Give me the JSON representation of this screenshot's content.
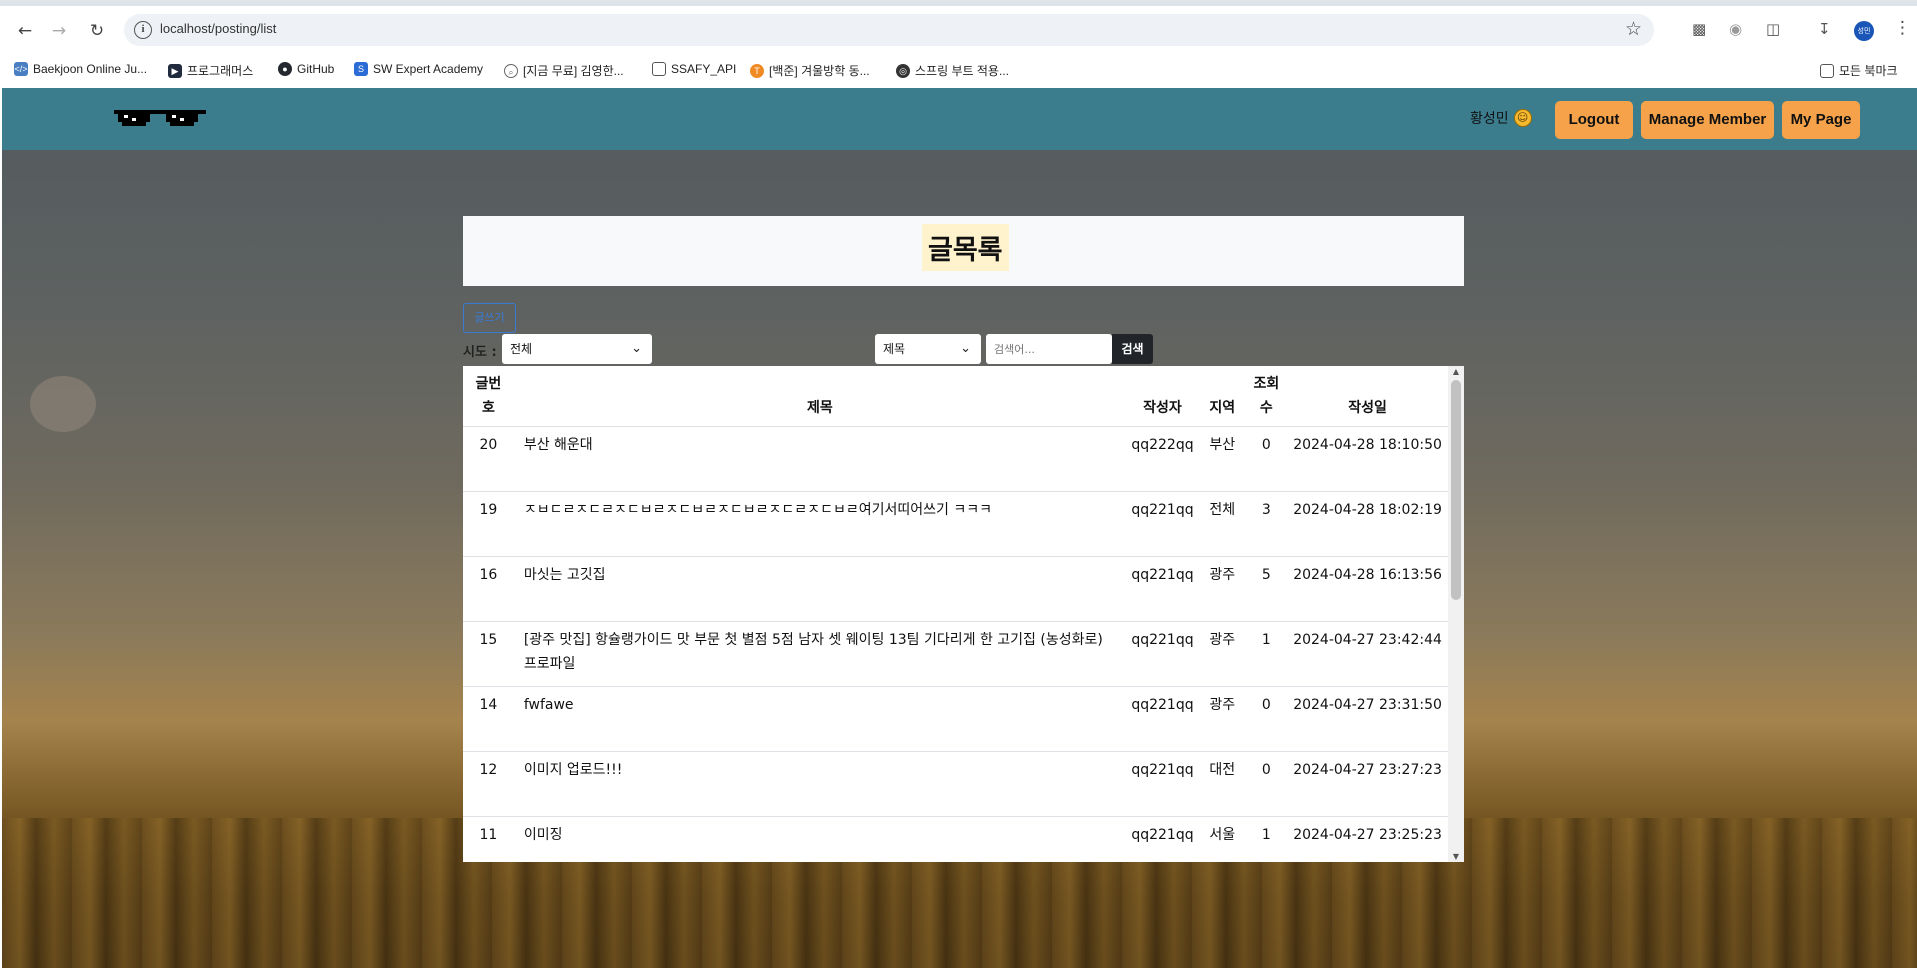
{
  "browser": {
    "url": "localhost/posting/list",
    "profile_initials": "성민",
    "bookmarks": [
      {
        "label": "Baekjoon Online Ju...",
        "icon": "code-icon",
        "color": "#4a7ec2"
      },
      {
        "label": "프로그래머스",
        "icon": "programmers-icon",
        "color": "#202b3d"
      },
      {
        "label": "GitHub",
        "icon": "github-icon",
        "color": "#24292f"
      },
      {
        "label": "SW Expert Academy",
        "icon": "swea-icon",
        "color": "#2a6bd6"
      },
      {
        "label": "[지금 무료] 김영한...",
        "icon": "search-icon",
        "color": "#666666"
      },
      {
        "label": "SSAFY_API",
        "icon": "folder-icon",
        "color": "#555555"
      },
      {
        "label": "[백준] 겨울방학 동...",
        "icon": "notion-icon",
        "color": "#f08a24"
      },
      {
        "label": "스프링 부트 적용...",
        "icon": "globe-icon",
        "color": "#333333"
      }
    ],
    "all_bookmarks": "모든 북마크"
  },
  "nav": {
    "username": "황성민",
    "logout": "Logout",
    "manage_member": "Manage Member",
    "my_page": "My Page"
  },
  "main": {
    "title": "글목록",
    "write_button": "글쓰기",
    "sido_label": "시도 :",
    "sido_selected": "전체",
    "search_field_selected": "제목",
    "search_placeholder": "검색어...",
    "search_button": "검색"
  },
  "table": {
    "headers": {
      "num_line1": "글번",
      "num_line2": "호",
      "title": "제목",
      "writer": "작성자",
      "region": "지역",
      "views_line1": "조회",
      "views_line2": "수",
      "date": "작성일"
    },
    "rows": [
      {
        "num": "20",
        "title": "부산 해운대",
        "writer": "qq222qq",
        "region": "부산",
        "views": "0",
        "date": "2024-04-28 18:10:50"
      },
      {
        "num": "19",
        "title": "ㅈㅂㄷㄹㅈㄷㄹㅈㄷㅂㄹㅈㄷㅂㄹㅈㄷㅂㄹㅈㄷㄹㅈㄷㅂㄹ여기서띠어쓰기 ㅋㅋㅋ",
        "writer": "qq221qq",
        "region": "전체",
        "views": "3",
        "date": "2024-04-28 18:02:19"
      },
      {
        "num": "16",
        "title": "마싯는 고깃집",
        "writer": "qq221qq",
        "region": "광주",
        "views": "5",
        "date": "2024-04-28 16:13:56"
      },
      {
        "num": "15",
        "title": "[광주 맛집] 항슐랭가이드 맛 부문 첫 별점 5점 남자 셋 웨이팅 13팀 기다리게 한 고기집 (농성화로) 프로파일",
        "writer": "qq221qq",
        "region": "광주",
        "views": "1",
        "date": "2024-04-27 23:42:44"
      },
      {
        "num": "14",
        "title": "fwfawe",
        "writer": "qq221qq",
        "region": "광주",
        "views": "0",
        "date": "2024-04-27 23:31:50"
      },
      {
        "num": "12",
        "title": "이미지 업로드!!!",
        "writer": "qq221qq",
        "region": "대전",
        "views": "0",
        "date": "2024-04-27 23:27:23"
      },
      {
        "num": "11",
        "title": "이미징",
        "writer": "qq221qq",
        "region": "서울",
        "views": "1",
        "date": "2024-04-27 23:25:23"
      }
    ]
  },
  "colors": {
    "navbar": "#3b7c8d",
    "nav_button": "#f5a24a",
    "title_highlight": "#fff3cd",
    "search_button": "#212529"
  }
}
